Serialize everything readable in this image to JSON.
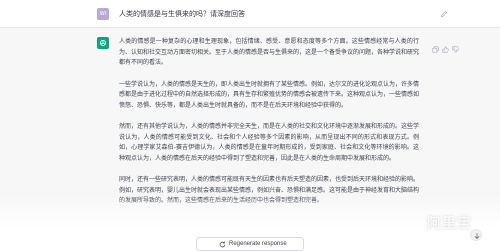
{
  "user_message": {
    "avatar_initials": "WI",
    "text": "人类的情感是与生俱来的吗？请深度回答"
  },
  "assistant_message": {
    "paragraphs": [
      "人类的情感是一种复杂的心理和生理现象，包括情绪、感受、意愿和态度等多个方面。这些情感经常与人类的行为、认知和社交互动方面密切相关。至于人类的情感是否与生俱来的，这是一个备受争议的问题，各种学说和研究都有不同的看法。",
      "一些学说认为，人类的情感是天生的，即人类出生时就拥有了某些情感。例如，达尔文的进化论观点认为，许多情感都是由于进化过程中的自然选择形成的，具有生存和繁殖优势的情感会被遗传下来。这种观点认为，一些情感如愤怒、恐惧、快乐等，都是人类出生时就具备的，而不是在后天环境和经验中获得的。",
      "然而，还有其他学说认为，人类的情感并非完全天生，而是在人类的社交和文化环境中逐渐发展和形成的。这些学说认为，人类的情感可能受到文化、社会和个人经验等多个因素的影响，从而呈现出不同的形式和表现方式。例如，心理学家艾森伯-赛吉伊德认为，人类的情感是在童年时期形成的，受到家庭、社会和文化等环境的影响。这种观点认为，人类的情感在后天的经验中得到了塑造和完善，因此是在人类的生命周期中发展和形成的。",
      "同时，还有一些研究表明，人类的情感可能既有天生的因素也有后天塑造的因素，也受到后天环境和经验的影响。例如，研究表明，婴儿出生时就会表现出某些情感，例如兴奋、恐惧和满足感。这可能是由于神经发育和大脑结构的发展所导致的。然而，这些情感在后来的生活经历中也会得到塑造和完善。"
    ]
  },
  "icons": {
    "user_edit": "pencil-edit-icon",
    "copy": "copy-icon",
    "thumb_up": "thumb-up-icon",
    "thumb_down": "thumb-down-icon",
    "regenerate": "refresh-icon",
    "scroll_down": "arrow-down-icon"
  },
  "regenerate_button": {
    "label": "Regenerate response"
  },
  "watermark_text": "阿里宝",
  "colors": {
    "assistant_avatar": "#10a37f",
    "assistant_background": "#f7f7f8",
    "user_avatar": "#b9a9d4"
  }
}
